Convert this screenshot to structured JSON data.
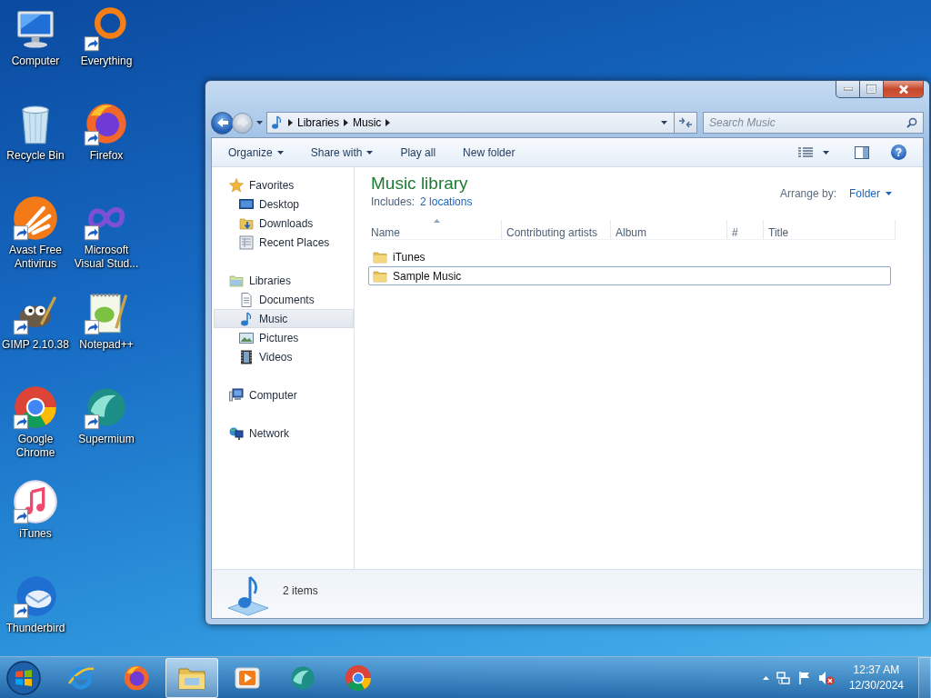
{
  "desktop_icons": [
    {
      "label": "Computer",
      "shortcut": false
    },
    {
      "label": "Recycle Bin",
      "shortcut": false
    },
    {
      "label": "Avast Free Antivirus",
      "shortcut": true
    },
    {
      "label": "GIMP 2.10.38",
      "shortcut": true
    },
    {
      "label": "Google Chrome",
      "shortcut": true
    },
    {
      "label": "iTunes",
      "shortcut": true
    },
    {
      "label": "Thunderbird",
      "shortcut": true
    },
    {
      "label": "Everything",
      "shortcut": true
    },
    {
      "label": "Firefox",
      "shortcut": true
    },
    {
      "label": "Microsoft Visual Stud...",
      "shortcut": true
    },
    {
      "label": "Notepad++",
      "shortcut": true
    },
    {
      "label": "Supermium",
      "shortcut": true
    }
  ],
  "explorer": {
    "back": {
      "disabled": false
    },
    "forward": {
      "disabled": true
    },
    "breadcrumbs": [
      "Libraries",
      "Music"
    ],
    "search": {
      "placeholder": "Search Music"
    },
    "commands": [
      {
        "label": "Organize",
        "dropdown": true
      },
      {
        "label": "Share with",
        "dropdown": true
      },
      {
        "label": "Play all",
        "dropdown": false
      },
      {
        "label": "New folder",
        "dropdown": false
      }
    ],
    "help": "?",
    "navigation": [
      {
        "label": "Favorites",
        "selected": false,
        "children": [
          {
            "label": "Desktop",
            "selected": false
          },
          {
            "label": "Downloads",
            "selected": false
          },
          {
            "label": "Recent Places",
            "selected": false
          }
        ]
      },
      {
        "label": "Libraries",
        "selected": false,
        "children": [
          {
            "label": "Documents",
            "selected": false
          },
          {
            "label": "Music",
            "selected": true
          },
          {
            "label": "Pictures",
            "selected": false
          },
          {
            "label": "Videos",
            "selected": false
          }
        ]
      },
      {
        "label": "Computer",
        "selected": false
      },
      {
        "label": "Network",
        "selected": false
      }
    ],
    "library": {
      "title": "Music library",
      "includes_label": "Includes:",
      "locations_link": "2 locations",
      "arrange_label": "Arrange by:",
      "arrange_value": "Folder"
    },
    "columns": [
      {
        "label": "Name",
        "sorted": true
      },
      {
        "label": "Contributing artists",
        "sorted": false
      },
      {
        "label": "Album",
        "sorted": false
      },
      {
        "label": "#",
        "sorted": false
      },
      {
        "label": "Title",
        "sorted": false
      }
    ],
    "files": [
      {
        "name": "iTunes",
        "focused": false
      },
      {
        "name": "Sample Music",
        "focused": true
      }
    ],
    "status": "2 items"
  },
  "taskbar": {
    "apps": [
      {
        "active": false
      },
      {
        "active": false
      },
      {
        "active": true
      },
      {
        "active": false
      },
      {
        "active": false
      },
      {
        "active": false
      }
    ],
    "volume_muted": true,
    "clock": {
      "time": "12:37 AM",
      "date": "12/30/2024"
    }
  }
}
